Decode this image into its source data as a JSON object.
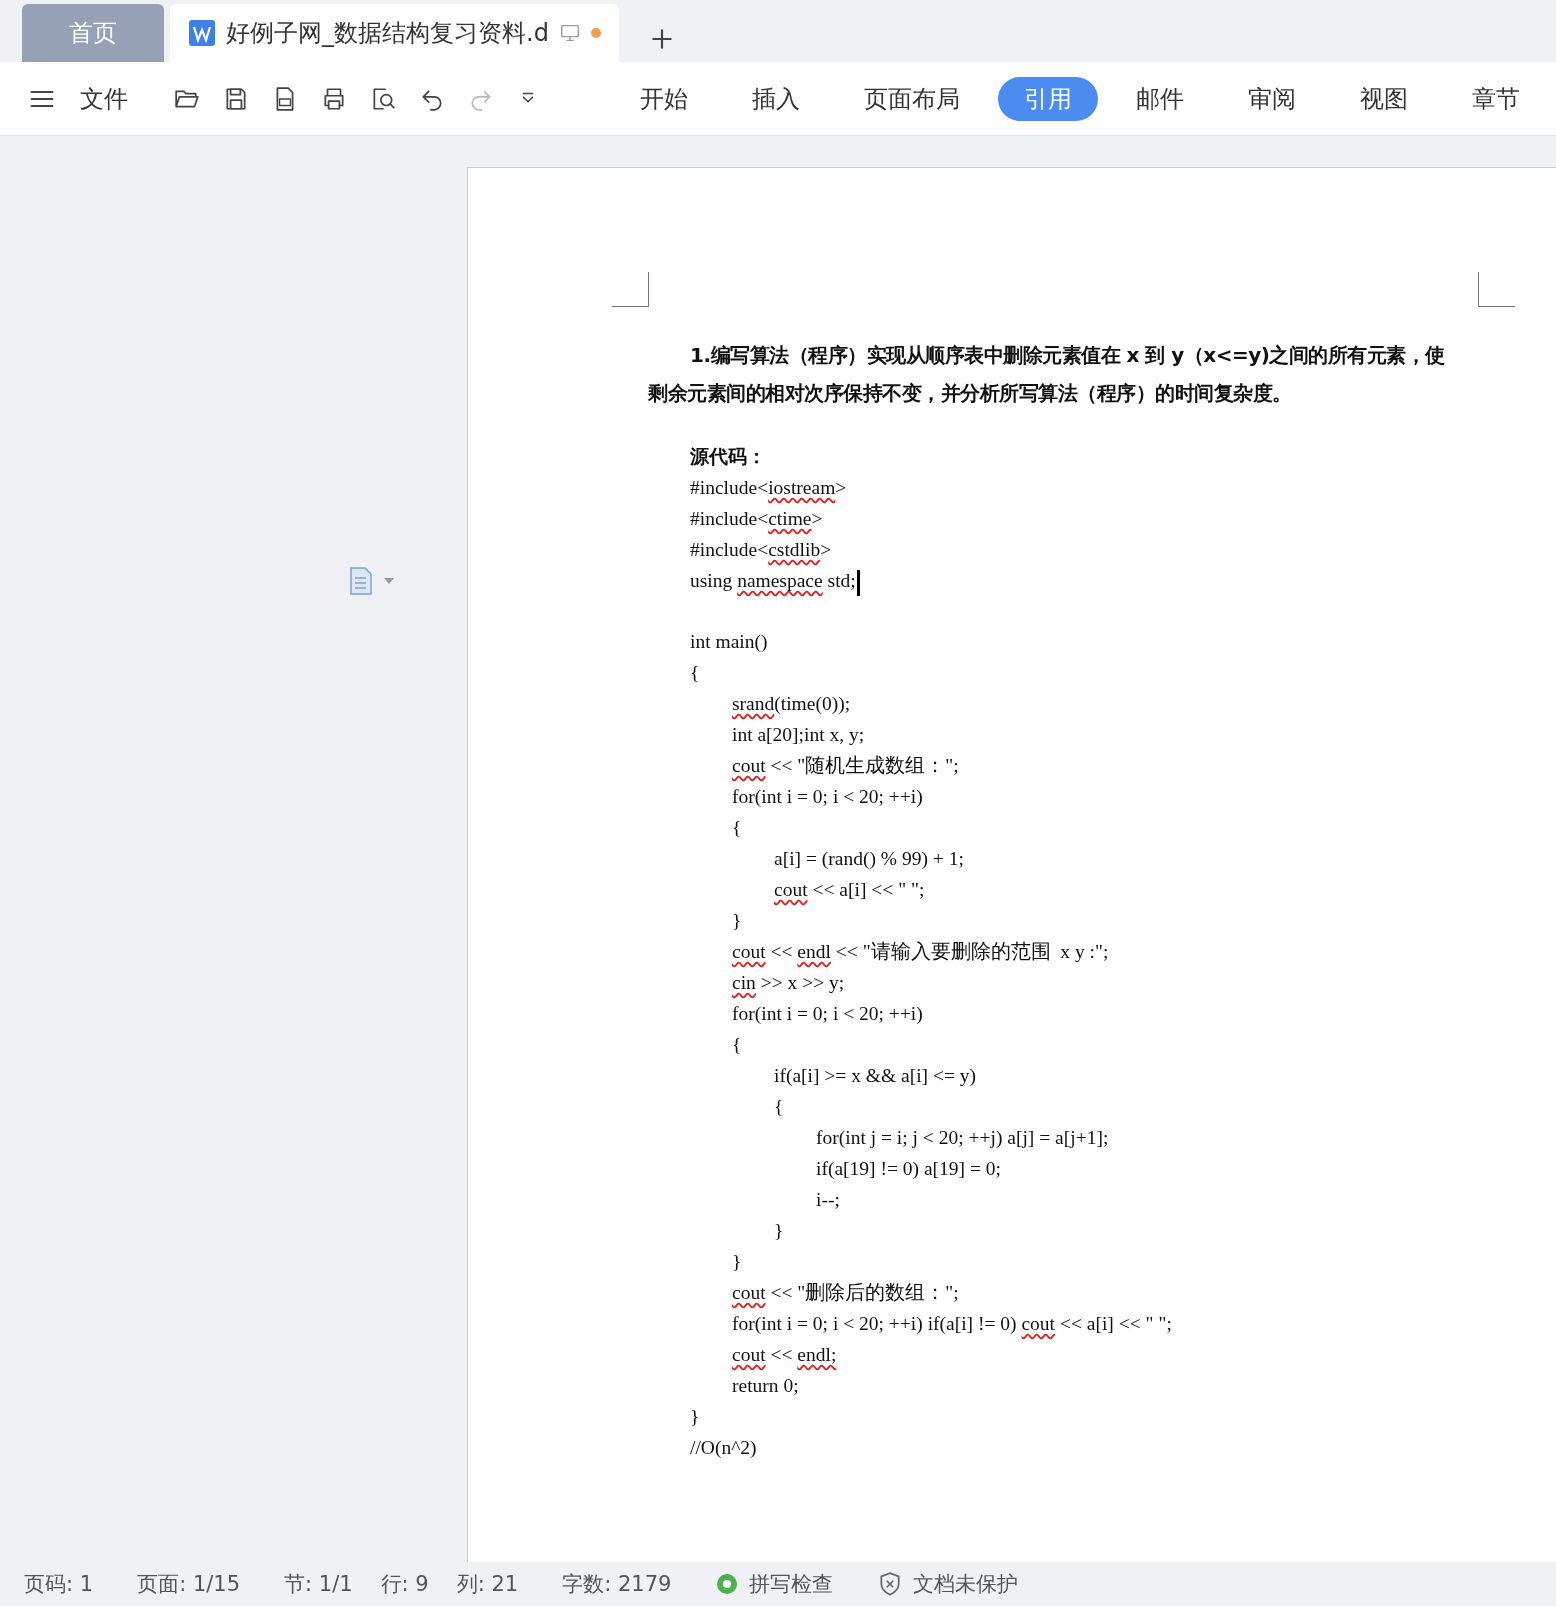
{
  "document_tabs": [
    {
      "label": "首页",
      "kind": "home",
      "selected": false,
      "modified": false
    },
    {
      "label": "好例子网_数据结构复习资料.d",
      "kind": "document",
      "selected": true,
      "modified": true
    }
  ],
  "toolbar": {
    "menu_label": "文件",
    "redo_disabled": true
  },
  "ribbon_tabs": [
    {
      "label": "开始",
      "selected": false
    },
    {
      "label": "插入",
      "selected": false
    },
    {
      "label": "页面布局",
      "selected": false
    },
    {
      "label": "引用",
      "selected": true
    },
    {
      "label": "邮件",
      "selected": false
    },
    {
      "label": "审阅",
      "selected": false
    },
    {
      "label": "视图",
      "selected": false
    },
    {
      "label": "章节",
      "selected": false
    }
  ],
  "document": {
    "heading": "1.编写算法（程序）实现从顺序表中删除元素值在 x 到 y（x<=y)之间的所有元素，使剩余元素间的相对次序保持不变，并分析所写算法（程序）的时间复杂度。",
    "code_label": "源代码：",
    "code_lines": [
      {
        "kind": "code",
        "has_cursor": false,
        "segments": [
          {
            "text": "#include<",
            "misspelled": false
          },
          {
            "text": "iostream",
            "misspelled": true
          },
          {
            "text": ">",
            "misspelled": false
          }
        ]
      },
      {
        "kind": "code",
        "has_cursor": false,
        "segments": [
          {
            "text": "#include<",
            "misspelled": false
          },
          {
            "text": "ctime",
            "misspelled": true
          },
          {
            "text": ">",
            "misspelled": false
          }
        ]
      },
      {
        "kind": "code",
        "has_cursor": false,
        "segments": [
          {
            "text": "#include<",
            "misspelled": false
          },
          {
            "text": "cstdlib",
            "misspelled": true
          },
          {
            "text": ">",
            "misspelled": false
          }
        ]
      },
      {
        "kind": "code",
        "has_cursor": true,
        "segments": [
          {
            "text": "using ",
            "misspelled": false
          },
          {
            "text": "namespace",
            "misspelled": true
          },
          {
            "text": " std;",
            "misspelled": false
          }
        ]
      },
      {
        "kind": "blank",
        "has_cursor": false
      },
      {
        "kind": "code",
        "has_cursor": false,
        "segments": [
          {
            "text": "int main()",
            "misspelled": false
          }
        ]
      },
      {
        "kind": "code",
        "has_cursor": false,
        "segments": [
          {
            "text": "{",
            "misspelled": false
          }
        ]
      },
      {
        "kind": "code",
        "has_cursor": false,
        "segments": [
          {
            "text": "\tsrand",
            "misspelled": true
          },
          {
            "text": "(time(0));",
            "misspelled": false
          }
        ]
      },
      {
        "kind": "code",
        "has_cursor": false,
        "segments": [
          {
            "text": "\tint a[20];int x, y;",
            "misspelled": false
          }
        ]
      },
      {
        "kind": "code",
        "has_cursor": false,
        "segments": [
          {
            "text": "\tcout",
            "misspelled": true
          },
          {
            "text": " << \"随机生成数组：\";",
            "misspelled": false
          }
        ]
      },
      {
        "kind": "code",
        "has_cursor": false,
        "segments": [
          {
            "text": "\tfor(int i = 0; i < 20; ++i)",
            "misspelled": false
          }
        ]
      },
      {
        "kind": "code",
        "has_cursor": false,
        "segments": [
          {
            "text": "\t{",
            "misspelled": false
          }
        ]
      },
      {
        "kind": "code",
        "has_cursor": false,
        "segments": [
          {
            "text": "\t\ta[i] = (rand() % 99) + 1;",
            "misspelled": false
          }
        ]
      },
      {
        "kind": "code",
        "has_cursor": false,
        "segments": [
          {
            "text": "\t\tcout",
            "misspelled": true
          },
          {
            "text": " << a[i] << \" \";",
            "misspelled": false
          }
        ]
      },
      {
        "kind": "code",
        "has_cursor": false,
        "segments": [
          {
            "text": "\t}",
            "misspelled": false
          }
        ]
      },
      {
        "kind": "code",
        "has_cursor": false,
        "segments": [
          {
            "text": "\tcout",
            "misspelled": true
          },
          {
            "text": " << ",
            "misspelled": false
          },
          {
            "text": "endl",
            "misspelled": true
          },
          {
            "text": " << \"请输入要删除的范围  x y :\";",
            "misspelled": false
          }
        ]
      },
      {
        "kind": "code",
        "has_cursor": false,
        "segments": [
          {
            "text": "\tcin",
            "misspelled": true
          },
          {
            "text": " >> x >> y;",
            "misspelled": false
          }
        ]
      },
      {
        "kind": "code",
        "has_cursor": false,
        "segments": [
          {
            "text": "\tfor(int i = 0; i < 20; ++i)",
            "misspelled": false
          }
        ]
      },
      {
        "kind": "code",
        "has_cursor": false,
        "segments": [
          {
            "text": "\t{",
            "misspelled": false
          }
        ]
      },
      {
        "kind": "code",
        "has_cursor": false,
        "segments": [
          {
            "text": "\t\tif(a[i] >= x && a[i] <= y)",
            "misspelled": false
          }
        ]
      },
      {
        "kind": "code",
        "has_cursor": false,
        "segments": [
          {
            "text": "\t\t{",
            "misspelled": false
          }
        ]
      },
      {
        "kind": "code",
        "has_cursor": false,
        "segments": [
          {
            "text": "\t\t\tfor(int j = i; j < 20; ++j) a[j] = a[j+1];",
            "misspelled": false
          }
        ]
      },
      {
        "kind": "code",
        "has_cursor": false,
        "segments": [
          {
            "text": "\t\t\tif(a[19] != 0) a[19] = 0;",
            "misspelled": false
          }
        ]
      },
      {
        "kind": "code",
        "has_cursor": false,
        "segments": [
          {
            "text": "\t\t\ti--;",
            "misspelled": false
          }
        ]
      },
      {
        "kind": "code",
        "has_cursor": false,
        "segments": [
          {
            "text": "\t\t}",
            "misspelled": false
          }
        ]
      },
      {
        "kind": "code",
        "has_cursor": false,
        "segments": [
          {
            "text": "\t}",
            "misspelled": false
          }
        ]
      },
      {
        "kind": "code",
        "has_cursor": false,
        "segments": [
          {
            "text": "\tcout",
            "misspelled": true
          },
          {
            "text": " << \"删除后的数组：\";",
            "misspelled": false
          }
        ]
      },
      {
        "kind": "code",
        "has_cursor": false,
        "segments": [
          {
            "text": "\tfor(int i = 0; i < 20; ++i) if(a[i] != 0) ",
            "misspelled": false
          },
          {
            "text": "cout",
            "misspelled": true
          },
          {
            "text": " << a[i] << \" \";",
            "misspelled": false
          }
        ]
      },
      {
        "kind": "code",
        "has_cursor": false,
        "segments": [
          {
            "text": "\tcout",
            "misspelled": true
          },
          {
            "text": " << ",
            "misspelled": false
          },
          {
            "text": "endl;",
            "misspelled": true
          }
        ]
      },
      {
        "kind": "code",
        "has_cursor": false,
        "segments": [
          {
            "text": "\treturn 0;",
            "misspelled": false
          }
        ]
      },
      {
        "kind": "code",
        "has_cursor": false,
        "segments": [
          {
            "text": "}",
            "misspelled": false
          }
        ]
      },
      {
        "kind": "code",
        "has_cursor": false,
        "segments": [
          {
            "text": "//O(n^2)",
            "misspelled": false
          }
        ]
      }
    ]
  },
  "status_bar": [
    {
      "kind": "text",
      "label": "页码: 1"
    },
    {
      "kind": "text",
      "label": "页面: 1/15"
    },
    {
      "kind": "text",
      "label": "节: 1/1"
    },
    {
      "kind": "text",
      "label": "行: 9"
    },
    {
      "kind": "text",
      "label": "列: 21"
    },
    {
      "kind": "text",
      "label": "字数: 2179"
    },
    {
      "kind": "spellcheck",
      "label": "拼写检查",
      "on": true
    },
    {
      "kind": "protection",
      "label": "文档未保护"
    }
  ]
}
